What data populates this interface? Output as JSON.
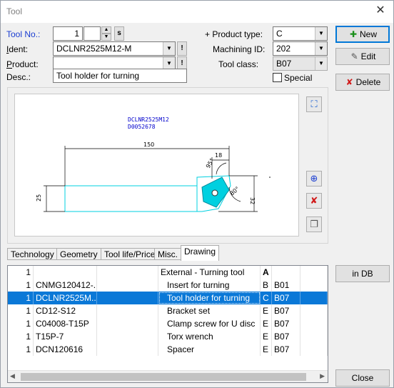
{
  "window": {
    "title": "Tool",
    "close_glyph": "✕"
  },
  "form": {
    "tool_no_label": "Tool No.:",
    "tool_no_value": "1",
    "tool_no_sub": "",
    "ident_label": "Ident:",
    "ident_value": "DCLNR2525M12-M",
    "product_label": "Product:",
    "product_value": "",
    "desc_label": "Desc.:",
    "desc_value": "Tool holder for turning",
    "product_type_label": "+ Product type:",
    "product_type_value": "C",
    "machining_id_label": "Machining ID:",
    "machining_id_value": "202",
    "tool_class_label": "Tool class:",
    "tool_class_value": "B07",
    "special_label": "Special",
    "special_checked": false,
    "excl_glyph": "!",
    "s_glyph": "s"
  },
  "buttons": {
    "new": "New",
    "edit": "Edit",
    "delete": "Delete",
    "in_db": "in DB",
    "close": "Close"
  },
  "drawing": {
    "ident_text": "DCLNR2525M12",
    "code_text": "D0052678",
    "dim_150": "150",
    "dim_18": "18",
    "dim_25": "25",
    "dim_32": "32",
    "angle_1": "95°",
    "angle_2": "80°"
  },
  "tabs": [
    "Technology",
    "Geometry",
    "Tool life/Price",
    "Misc.",
    "Drawing"
  ],
  "active_tab": "Drawing",
  "table": {
    "rows": [
      {
        "qty": "1",
        "code": "",
        "name": "External - Turning tool",
        "t": "A",
        "cls": "",
        "header": true
      },
      {
        "qty": "1",
        "code": "CNMG120412-...",
        "name": "Insert for turning",
        "t": "B",
        "cls": "B01"
      },
      {
        "qty": "1",
        "code": "DCLNR2525M...",
        "name": "Tool holder for turning",
        "t": "C",
        "cls": "B07",
        "selected": true
      },
      {
        "qty": "1",
        "code": "CD12-S12",
        "name": "Bracket set",
        "t": "E",
        "cls": "B07"
      },
      {
        "qty": "1",
        "code": "C04008-T15P",
        "name": "Clamp screw for U disc",
        "t": "E",
        "cls": "B07"
      },
      {
        "qty": "1",
        "code": "T15P-7",
        "name": "Torx wrench",
        "t": "E",
        "cls": "B07"
      },
      {
        "qty": "1",
        "code": "DCN120616",
        "name": "Spacer",
        "t": "E",
        "cls": "B07"
      }
    ]
  },
  "colors": {
    "accent": "#0a78d7",
    "label_blue": "#1a3dd1",
    "tool_cyan": "#00d0e0"
  }
}
